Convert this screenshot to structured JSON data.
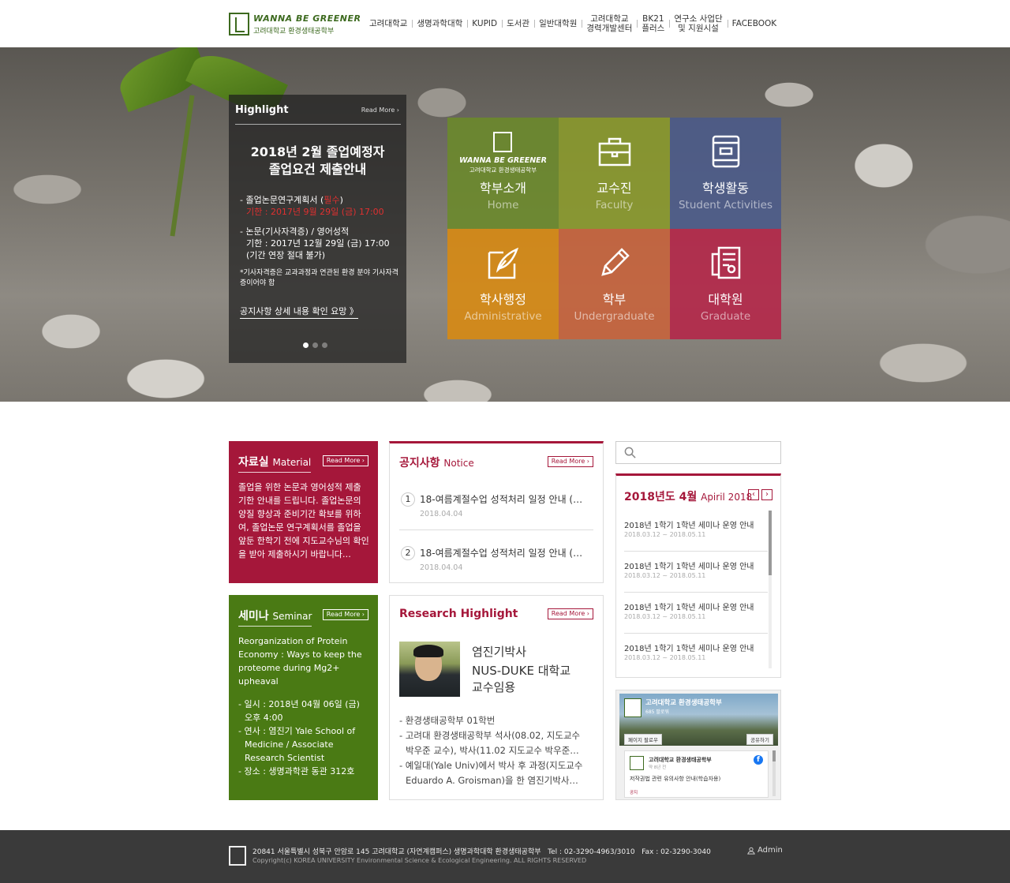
{
  "logo": {
    "title": "WANNA BE GREENER",
    "subtitle": "고려대학교 환경생태공학부"
  },
  "gnb": [
    {
      "label": "고려대학교"
    },
    {
      "label": "생명과학대학"
    },
    {
      "label": "KUPID"
    },
    {
      "label": "도서관"
    },
    {
      "label": "일반대학원"
    },
    {
      "label": "고려대학교\n경력개발센터"
    },
    {
      "label": "BK21\n플러스"
    },
    {
      "label": "연구소 사업단\n및 지원시설"
    },
    {
      "label": "FACEBOOK"
    }
  ],
  "highlight": {
    "heading": "Highlight",
    "read_more": "Read More ›",
    "title": "2018년 2월 졸업예정자\n졸업요건 제출안내",
    "line1_a": "- 졸업논문연구계획서 (",
    "line1_b": "필수",
    "line1_c": ")",
    "line2": "기한 : 2017년 9월 29일 (금) 17:00",
    "line3": "- 논문(기사자격증) / 영어성적",
    "line4": "기한 : 2017년 12월 29일 (금) 17:00",
    "line5": "(기간 연장 절대 불가)",
    "note": "*기사자격증은 교과과정과 연관된 환경 분야 기사자격증이어야 함",
    "link": "공지사항 상세 내용 확인 요망 》"
  },
  "tiles": [
    {
      "ko": "학부소개",
      "en": "Home",
      "color": "#6b8a2a",
      "logo_t1": "WANNA BE GREENER",
      "logo_t2": "고려대학교 환경생태공학부"
    },
    {
      "ko": "교수진",
      "en": "Faculty",
      "color": "#8a9a2a"
    },
    {
      "ko": "학생활동",
      "en": "Student Activities",
      "color": "#4a5a8a"
    },
    {
      "ko": "학사행정",
      "en": "Administrative",
      "color": "#d98a10"
    },
    {
      "ko": "학부",
      "en": "Undergraduate",
      "color": "#c8623a"
    },
    {
      "ko": "대학원",
      "en": "Graduate",
      "color": "#b52448"
    }
  ],
  "material": {
    "title": "자료실",
    "title_en": "Material",
    "read_more": "Read More ›",
    "text": "졸업을 위한 논문과 영어성적 제출 기한 안내를 드립니다. 졸업논문의 양질 향상과 준비기간 확보를 위하여, 졸업논문 연구계획서를 졸업을 앞둔 한학기 전에 지도교수님의 확인을 받아 제출하시기 바랍니다…"
  },
  "seminar": {
    "title": "세미나",
    "title_en": "Seminar",
    "read_more": "Read More ›",
    "text": "Reorganization of Protein Economy : Ways to keep the proteome during Mg2+ upheaval",
    "d1": "- 일시 : 2018년 04월 06일 (금)",
    "d2": "오후 4:00",
    "d3": "- 연사 : 염진기 Yale School of",
    "d4": "Medicine / Associate",
    "d5": "Research Scientist",
    "d6": "- 장소 : 생명과학관 동관 312호"
  },
  "notice": {
    "title": "공지사항",
    "title_en": "Notice",
    "read_more": "Read More ›",
    "items": [
      {
        "num": "1",
        "title": "18-여름계절수업 성적처리 일정 안내 (…",
        "date": "2018.04.04"
      },
      {
        "num": "2",
        "title": "18-여름계절수업 성적처리 일정 안내 (…",
        "date": "2018.04.04"
      }
    ]
  },
  "research": {
    "title": "Research Highlight",
    "read_more": "Read More ›",
    "name": "염진기박사",
    "headline": "NUS-DUKE 대학교\n교수임용",
    "b1": "- 환경생태공학부 01학번",
    "b2": "- 고려대 환경생태공학부 석사(08.02, 지도교수",
    "b3": "박우준 교수), 박사(11.02 지도교수 박우준…",
    "b4": "- 예일대(Yale Univ)에서 박사 후 과정(지도교수",
    "b5": "Eduardo A. Groisman)을 한 염진기박사…"
  },
  "search": {
    "placeholder": ""
  },
  "calendar": {
    "title": "2018년도 4월",
    "title_en": "Apiril 2018",
    "items": [
      {
        "title": "2018년 1학기 1학년 세미나 운영 안내",
        "date": "2018.03.12 ~ 2018.05.11"
      },
      {
        "title": "2018년 1학기 1학년 세미나 운영 안내",
        "date": "2018.03.12 ~ 2018.05.11"
      },
      {
        "title": "2018년 1학기 1학년 세미나 운영 안내",
        "date": "2018.03.12 ~ 2018.05.11"
      },
      {
        "title": "2018년 1학기 1학년 세미나 운영 안내",
        "date": "2018.03.12 ~ 2018.05.11"
      }
    ]
  },
  "facebook": {
    "page": "고려대학교 환경생태공학부",
    "likes": "685 팔로워",
    "like_btn": "페이지 팔로우",
    "share_btn": "공유하기",
    "post_page": "고려대학교 환경생태공학부",
    "post_time": "약 8년 전",
    "post_text": "저작권법 관련 유의사항 안내(학습자용)",
    "post_tag": "공지"
  },
  "footer": {
    "address": "20841 서울특별시 성북구 안암로 145 고려대학교 (자연계캠퍼스) 생명과학대학 환경생태공학부   Tel : 02-3290-4963/3010   Fax : 02-3290-3040",
    "copyright": "Copyright(c) KOREA UNIVERSITY Environmental Science & Ecological Engineering. ALL RIGHTS RESERVED",
    "admin": "Admin"
  },
  "colors": {
    "brand_green": "#3d6a1f",
    "brand_red": "#a5173a",
    "seminar_green": "#4a7a14",
    "footer_bg": "#3a3a3a"
  }
}
